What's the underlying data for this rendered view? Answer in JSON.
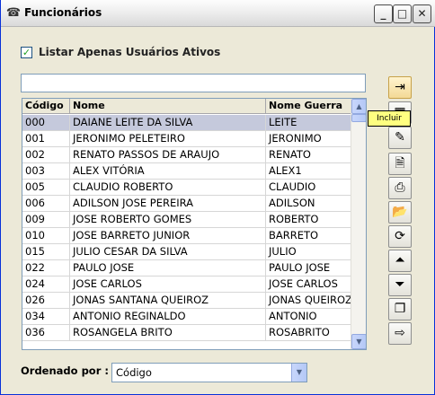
{
  "window": {
    "title": "Funcionários",
    "minimize": "_",
    "maximize": "□",
    "close": "✕"
  },
  "filter": {
    "active_only_label": "Listar Apenas Usuários Ativos",
    "active_only_checked": true,
    "search_value": ""
  },
  "grid": {
    "columns": [
      "Código",
      "Nome",
      "Nome Guerra"
    ],
    "rows": [
      [
        "000",
        "DAIANE LEITE DA SILVA",
        "LEITE"
      ],
      [
        "001",
        "JERONIMO PELETEIRO",
        "JERONIMO"
      ],
      [
        "002",
        "RENATO PASSOS DE ARAUJO",
        "RENATO"
      ],
      [
        "003",
        "ALEX VITÓRIA",
        "ALEX1"
      ],
      [
        "005",
        "CLAUDIO ROBERTO",
        "CLAUDIO"
      ],
      [
        "006",
        "ADILSON JOSE PEREIRA",
        "ADILSON"
      ],
      [
        "009",
        "JOSE ROBERTO GOMES",
        "ROBERTO"
      ],
      [
        "010",
        "JOSE BARRETO JUNIOR",
        "BARRETO"
      ],
      [
        "015",
        "JULIO CESAR DA SILVA",
        "JULIO"
      ],
      [
        "022",
        "PAULO JOSE",
        "PAULO JOSE"
      ],
      [
        "024",
        "JOSE CARLOS",
        "JOSE CARLOS"
      ],
      [
        "026",
        "JONAS SANTANA QUEIROZ",
        "JONAS QUEIROZ"
      ],
      [
        "034",
        "ANTONIO REGINALDO",
        "ANTONIO"
      ],
      [
        "036",
        "ROSANGELA BRITO",
        "ROSABRITO"
      ]
    ],
    "selected_index": 0
  },
  "toolbar": {
    "tooltip": "Incluir",
    "icons": [
      "add-record-icon",
      "edit-record-icon",
      "delete-record-icon",
      "preview-icon",
      "print-icon",
      "open-folder-icon",
      "refresh-icon",
      "move-first-icon",
      "move-last-icon",
      "duplicate-icon",
      "exit-icon"
    ]
  },
  "order": {
    "label": "Ordenado por :",
    "value": "Código"
  },
  "colors": {
    "window_bg": "#ece9d8",
    "selected_row": "#c5c9dc",
    "tooltip_bg": "#ffff80"
  }
}
